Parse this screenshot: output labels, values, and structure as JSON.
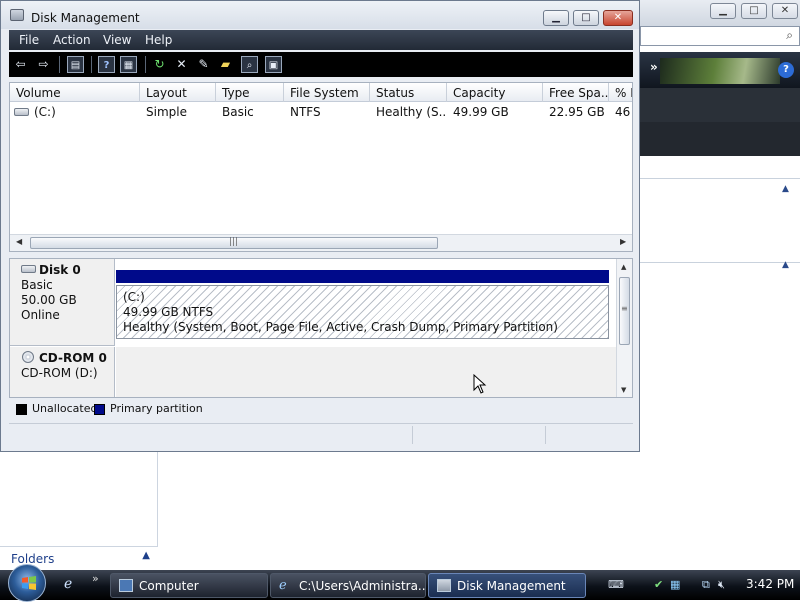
{
  "window": {
    "title": "Disk Management",
    "controls": {
      "minimize": "▁",
      "maximize": "□",
      "close": "✕"
    }
  },
  "menu": [
    "File",
    "Action",
    "View",
    "Help"
  ],
  "toolbar_icons": [
    "back-arrow-icon",
    "forward-arrow-icon",
    "console-tree-icon",
    "help-icon",
    "properties-icon",
    "refresh-icon",
    "delete-icon",
    "properties-edit-icon",
    "open-folder-icon",
    "rescan-icon",
    "wizard-icon"
  ],
  "volumes": {
    "columns": [
      "Volume",
      "Layout",
      "Type",
      "File System",
      "Status",
      "Capacity",
      "Free Spa...",
      "% F"
    ],
    "rows": [
      {
        "volume": "(C:)",
        "layout": "Simple",
        "type": "Basic",
        "fs": "NTFS",
        "status": "Healthy (S...",
        "capacity": "49.99 GB",
        "free": "22.95 GB",
        "pct": "46"
      }
    ]
  },
  "disks": [
    {
      "name": "Disk 0",
      "kind": "Basic",
      "size": "50.00 GB",
      "state": "Online"
    },
    {
      "name": "CD-ROM 0",
      "kind": "CD-ROM (D:)"
    }
  ],
  "partition": {
    "label": "(C:)",
    "size_fs": "49.99 GB NTFS",
    "status": "Healthy (System, Boot, Page File, Active, Crash Dump, Primary Partition)"
  },
  "legend": {
    "unallocated": "Unallocated",
    "primary": "Primary partition",
    "colors": {
      "unallocated": "#000000",
      "primary": "#000a8a"
    }
  },
  "background_window": {
    "folders_label": "Folders"
  },
  "taskbar": {
    "buttons": [
      {
        "label": "Computer"
      },
      {
        "label": "C:\\Users\\Administra..."
      },
      {
        "label": "Disk Management"
      }
    ],
    "quick_launch_more": "»",
    "clock": "3:42 PM"
  }
}
